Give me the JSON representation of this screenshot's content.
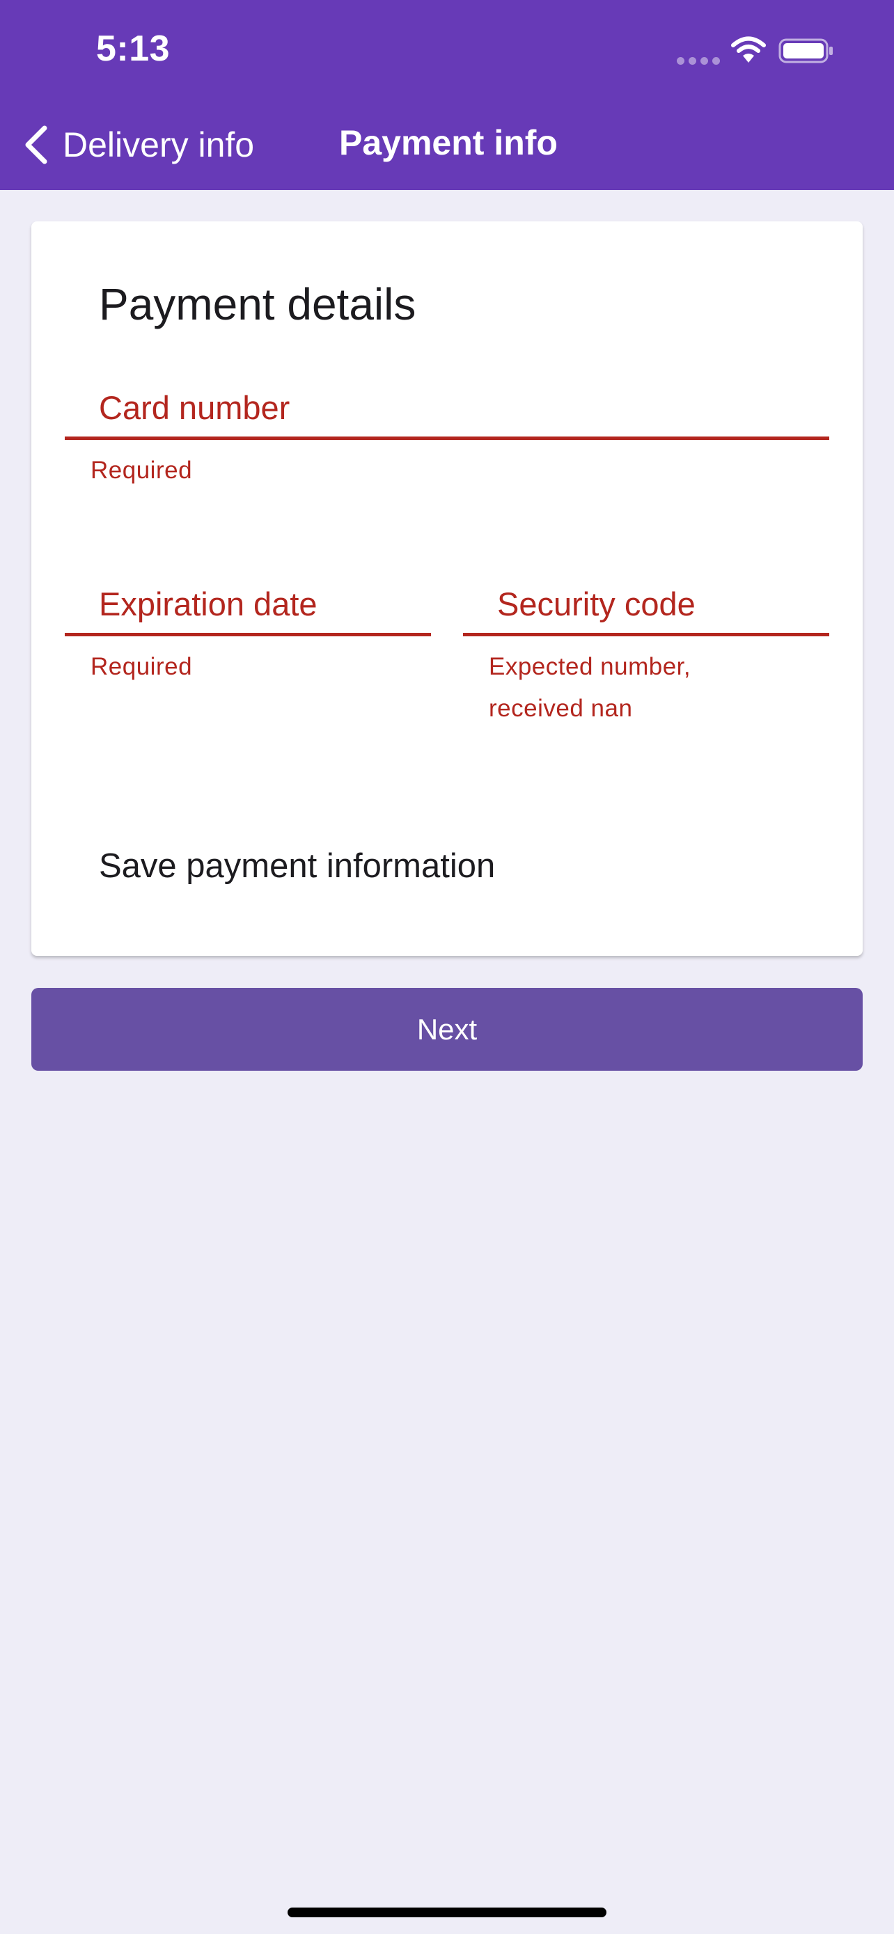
{
  "status_bar": {
    "time": "5:13"
  },
  "nav": {
    "back_label": "Delivery info",
    "title": "Payment info"
  },
  "form": {
    "title": "Payment details",
    "card_number": {
      "label": "Card number",
      "value": "",
      "error": "Required"
    },
    "expiration_date": {
      "label": "Expiration date",
      "value": "",
      "error": "Required"
    },
    "security_code": {
      "label": "Security code",
      "value": "",
      "error_line1": "Expected number,",
      "error_line2": "received nan"
    },
    "save_payment_label": "Save payment information"
  },
  "actions": {
    "next_label": "Next"
  },
  "colors": {
    "header": "#673AB7",
    "primary_button": "#6750A4",
    "error": "#B3261E",
    "background": "#EEEDF7",
    "card": "#FFFFFF"
  },
  "icons": {
    "back": "chevron-back-icon",
    "wifi": "wifi-icon",
    "battery": "battery-icon",
    "signal": "signal-dots-icon"
  }
}
